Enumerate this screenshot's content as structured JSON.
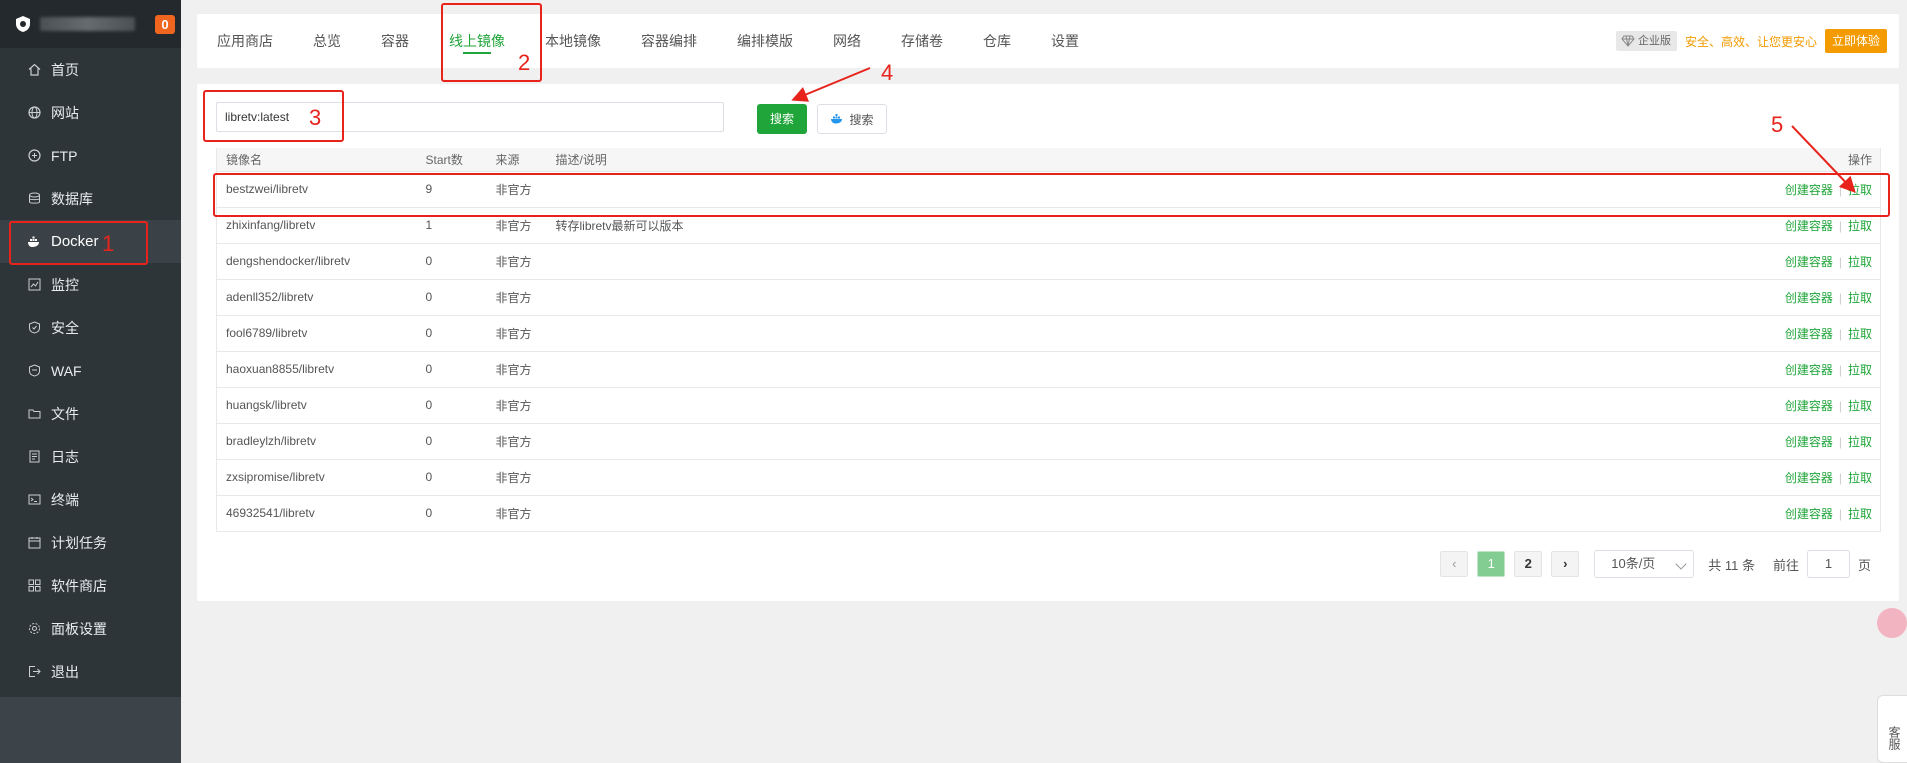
{
  "sidebar": {
    "badge": "0",
    "items": [
      {
        "label": "首页",
        "icon": "home-icon"
      },
      {
        "label": "网站",
        "icon": "globe-icon"
      },
      {
        "label": "FTP",
        "icon": "ftp-icon"
      },
      {
        "label": "数据库",
        "icon": "database-icon"
      },
      {
        "label": "Docker",
        "icon": "docker-icon"
      },
      {
        "label": "监控",
        "icon": "monitor-icon"
      },
      {
        "label": "安全",
        "icon": "shield-icon"
      },
      {
        "label": "WAF",
        "icon": "waf-icon"
      },
      {
        "label": "文件",
        "icon": "folder-icon"
      },
      {
        "label": "日志",
        "icon": "log-icon"
      },
      {
        "label": "终端",
        "icon": "terminal-icon"
      },
      {
        "label": "计划任务",
        "icon": "calendar-icon"
      },
      {
        "label": "软件商店",
        "icon": "apps-icon"
      },
      {
        "label": "面板设置",
        "icon": "settings-icon"
      },
      {
        "label": "退出",
        "icon": "logout-icon"
      }
    ]
  },
  "tabs": [
    "应用商店",
    "总览",
    "容器",
    "线上镜像",
    "本地镜像",
    "容器编排",
    "编排模版",
    "网络",
    "存储卷",
    "仓库",
    "设置"
  ],
  "promo": {
    "enterprise": "企业版",
    "slogan": "安全、高效、让您更安心",
    "try": "立即体验"
  },
  "search": {
    "value": "libretv:latest",
    "button": "搜索",
    "hub_button": "搜索"
  },
  "table": {
    "headers": [
      "镜像名",
      "Start数",
      "来源",
      "描述/说明",
      "操作"
    ],
    "actions": {
      "create": "创建容器",
      "pull": "拉取"
    },
    "rows": [
      {
        "name": "bestzwei/libretv",
        "stars": "9",
        "source": "非官方",
        "desc": ""
      },
      {
        "name": "zhixinfang/libretv",
        "stars": "1",
        "source": "非官方",
        "desc": "转存libretv最新可以版本"
      },
      {
        "name": "dengshendocker/libretv",
        "stars": "0",
        "source": "非官方",
        "desc": ""
      },
      {
        "name": "adenll352/libretv",
        "stars": "0",
        "source": "非官方",
        "desc": ""
      },
      {
        "name": "fool6789/libretv",
        "stars": "0",
        "source": "非官方",
        "desc": ""
      },
      {
        "name": "haoxuan8855/libretv",
        "stars": "0",
        "source": "非官方",
        "desc": ""
      },
      {
        "name": "huangsk/libretv",
        "stars": "0",
        "source": "非官方",
        "desc": ""
      },
      {
        "name": "bradleylzh/libretv",
        "stars": "0",
        "source": "非官方",
        "desc": ""
      },
      {
        "name": "zxsipromise/libretv",
        "stars": "0",
        "source": "非官方",
        "desc": ""
      },
      {
        "name": "46932541/libretv",
        "stars": "0",
        "source": "非官方",
        "desc": ""
      }
    ]
  },
  "pager": {
    "prev": "‹",
    "pages": [
      "1",
      "2"
    ],
    "next": "›",
    "page_size": "10条/页",
    "total": "共 11 条",
    "goto_label": "前往",
    "goto_value": "1",
    "goto_unit": "页"
  },
  "annotations": [
    "1",
    "2",
    "3",
    "4",
    "5"
  ],
  "float_cs": "客服",
  "colors": {
    "accent": "#20a53a",
    "annotation": "#e8231c",
    "promo": "#f39b00",
    "sidebar": "#2e3539"
  }
}
